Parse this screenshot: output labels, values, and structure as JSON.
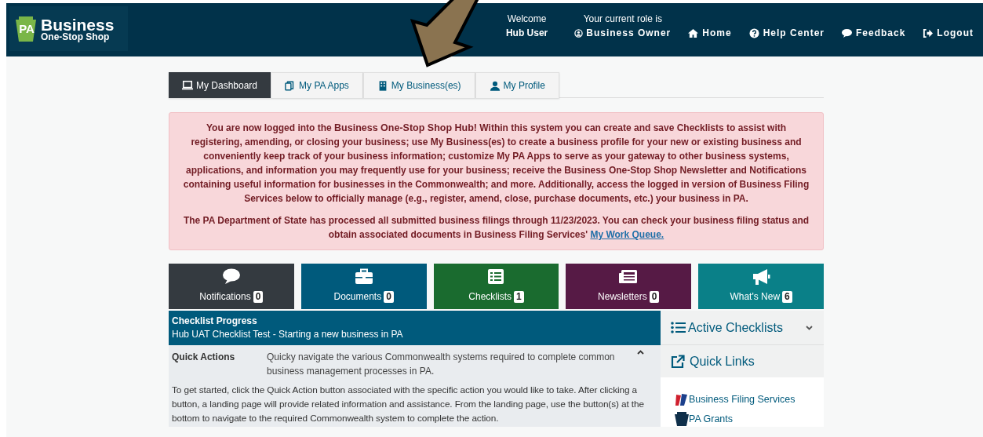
{
  "header": {
    "logo": {
      "badge": "PA",
      "title": "Business",
      "subtitle": "One-Stop Shop"
    },
    "welcome": {
      "label": "Welcome",
      "user": "Hub User"
    },
    "role": {
      "label": "Your current role is",
      "value": "Business Owner"
    },
    "nav": [
      {
        "label": "Home"
      },
      {
        "label": "Help Center"
      },
      {
        "label": "Feedback"
      },
      {
        "label": "Logout"
      }
    ]
  },
  "tabs": [
    {
      "label": "My Dashboard",
      "selected": true
    },
    {
      "label": "My PA Apps",
      "selected": false
    },
    {
      "label": "My Business(es)",
      "selected": false
    },
    {
      "label": "My Profile",
      "selected": false
    }
  ],
  "alert": {
    "paragraphs": [
      {
        "text": "You are now logged into the **Business One-Stop Shop Hub!** Within this system you can create and save Checklists to assist with registering, amending, or closing your business; use My Business(es) to create a business profile for your new or existing business and conveniently keep track of your business information; customize My PA Apps to serve as your gateway to other business systems, applications, and information you may frequently use for your business; receive the Business One-Stop Shop Newsletter and Notifications containing useful information for businesses in the Commonwealth; and more.  Additionally, access the logged in version of Business Filing Services below to officially manage (e.g., register, amend, close, purchase documents, etc.) your business in PA."
      },
      {
        "text": "The PA Department of State has processed all submitted business filings through 11/23/2023. You can check your business filing status and obtain associated documents in Business Filing Services' ",
        "link": "My Work Queue."
      }
    ]
  },
  "tiles": [
    {
      "label": "Notifications",
      "count": "0",
      "color": "#343a40"
    },
    {
      "label": "Documents",
      "count": "0",
      "color": "#005a7c"
    },
    {
      "label": "Checklists",
      "count": "1",
      "color": "#1a6b2f"
    },
    {
      "label": "Newsletters",
      "count": "0",
      "color": "#561a45"
    },
    {
      "label": "What's New",
      "count": "6",
      "color": "#0a8088"
    }
  ],
  "checklist_progress": {
    "title": "Checklist Progress",
    "subtitle": "Hub UAT Checklist Test - Starting a new business in PA"
  },
  "quick_actions": {
    "title": "Quick Actions",
    "summary": "Quicky navigate the various Commonwealth systems required to complete common business management processes in PA.",
    "expanded": true,
    "body": "To get started, click the Quick Action button associated with the specific action you would like to take. After clicking a button, a landing page will provide related information and assistance. From the landing page, use the button(s) at the bottom to navigate to the required Commonwealth system to complete the action."
  },
  "sidebar": {
    "active_checklists": {
      "title": "Active Checklists",
      "expanded": false
    },
    "quick_links": {
      "title": "Quick Links",
      "items": [
        {
          "label": "Business Filing Services"
        },
        {
          "label": "PA Grants"
        }
      ]
    }
  }
}
